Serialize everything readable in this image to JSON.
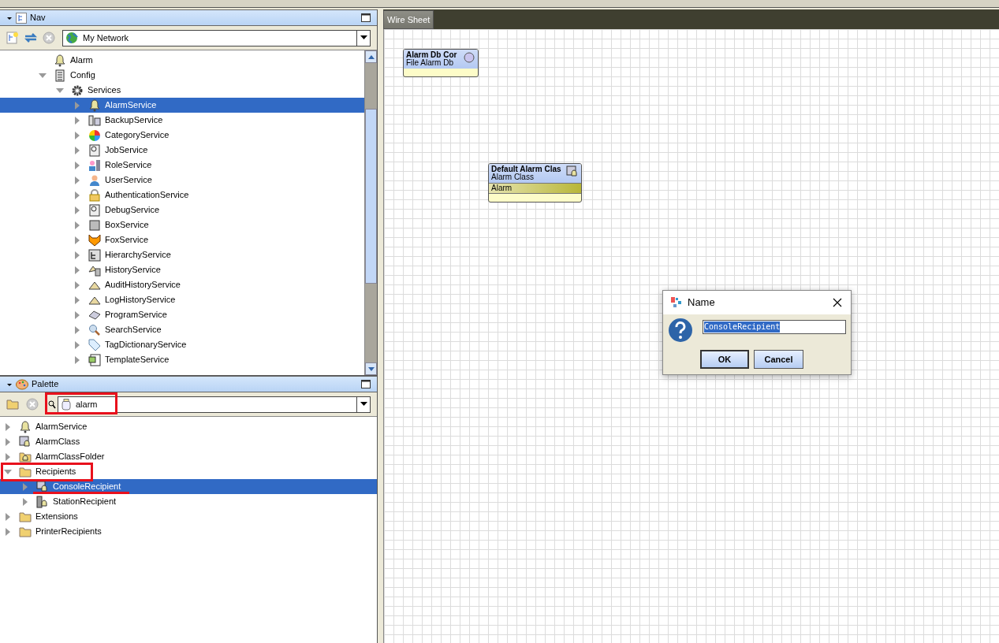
{
  "nav": {
    "title": "Nav",
    "location": "My Network",
    "tree": [
      {
        "label": "Alarm",
        "kind": "bell",
        "selected": false
      },
      {
        "label": "Config",
        "kind": "list",
        "selected": false,
        "expanded": true,
        "children": [
          {
            "label": "Services",
            "kind": "gear",
            "selected": false,
            "expanded": true,
            "children": [
              {
                "label": "AlarmService",
                "kind": "bell",
                "selected": true,
                "expanded": false
              },
              {
                "label": "BackupService",
                "kind": "backup",
                "selected": false,
                "expanded": false
              },
              {
                "label": "CategoryService",
                "kind": "pie",
                "selected": false,
                "expanded": false
              },
              {
                "label": "JobService",
                "kind": "scroll",
                "selected": false,
                "expanded": false
              },
              {
                "label": "RoleService",
                "kind": "role",
                "selected": false,
                "expanded": false
              },
              {
                "label": "UserService",
                "kind": "user",
                "selected": false,
                "expanded": false
              },
              {
                "label": "AuthenticationService",
                "kind": "lock",
                "selected": false,
                "expanded": false
              },
              {
                "label": "DebugService",
                "kind": "scroll",
                "selected": false,
                "expanded": false
              },
              {
                "label": "BoxService",
                "kind": "box",
                "selected": false,
                "expanded": false
              },
              {
                "label": "FoxService",
                "kind": "fox",
                "selected": false,
                "expanded": false
              },
              {
                "label": "HierarchyService",
                "kind": "hierarchy",
                "selected": false,
                "expanded": false
              },
              {
                "label": "HistoryService",
                "kind": "history",
                "selected": false,
                "expanded": false
              },
              {
                "label": "AuditHistoryService",
                "kind": "triangle",
                "selected": false,
                "expanded": false
              },
              {
                "label": "LogHistoryService",
                "kind": "triangle",
                "selected": false,
                "expanded": false
              },
              {
                "label": "ProgramService",
                "kind": "program",
                "selected": false,
                "expanded": false
              },
              {
                "label": "SearchService",
                "kind": "search",
                "selected": false,
                "expanded": false
              },
              {
                "label": "TagDictionaryService",
                "kind": "tag",
                "selected": false,
                "expanded": false
              },
              {
                "label": "TemplateService",
                "kind": "template",
                "selected": false,
                "expanded": false
              }
            ]
          }
        ]
      }
    ]
  },
  "palette": {
    "title": "Palette",
    "module": "alarm",
    "tree": [
      {
        "label": "AlarmService",
        "kind": "bell",
        "selected": false,
        "expanded": false
      },
      {
        "label": "AlarmClass",
        "kind": "alarmclass",
        "selected": false,
        "expanded": false
      },
      {
        "label": "AlarmClassFolder",
        "kind": "folderbell",
        "selected": false,
        "expanded": false
      },
      {
        "label": "Recipients",
        "kind": "folder",
        "selected": false,
        "expanded": true,
        "children": [
          {
            "label": "ConsoleRecipient",
            "kind": "console",
            "selected": true,
            "expanded": false
          },
          {
            "label": "StationRecipient",
            "kind": "station",
            "selected": false,
            "expanded": false
          }
        ]
      },
      {
        "label": "Extensions",
        "kind": "folder",
        "selected": false,
        "expanded": false
      },
      {
        "label": "PrinterRecipients",
        "kind": "folder",
        "selected": false,
        "expanded": false
      }
    ]
  },
  "wire_sheet": {
    "tab": "Wire Sheet",
    "nodes": [
      {
        "title": "Alarm Db Cor",
        "type": "File Alarm Db",
        "kind": "circle"
      },
      {
        "title": "Default Alarm Clas",
        "type": "Alarm Class",
        "kind": "alarmclass",
        "slot": "Alarm"
      }
    ]
  },
  "dialog": {
    "title": "Name",
    "value": "ConsoleRecipient",
    "buttons": [
      {
        "label": "OK",
        "default": true
      },
      {
        "label": "Cancel",
        "default": false
      }
    ]
  }
}
